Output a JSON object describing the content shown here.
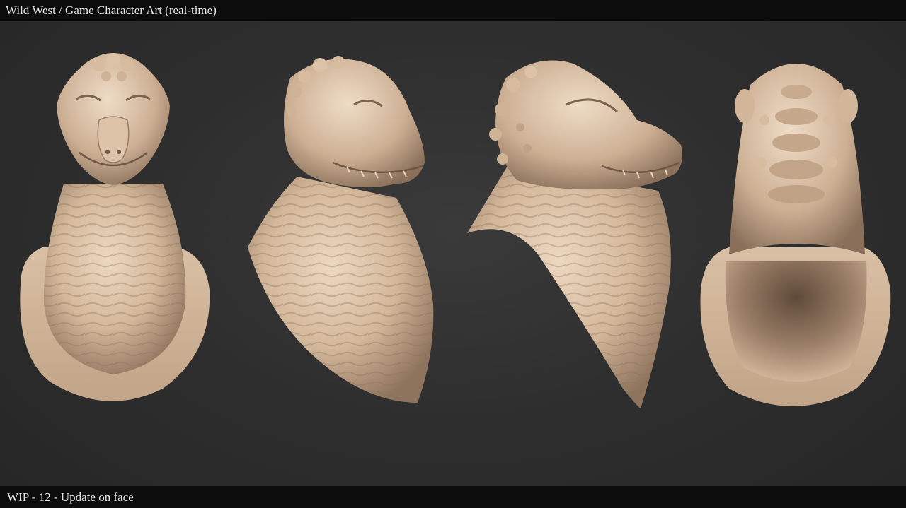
{
  "header": {
    "title": "Wild West / Game Character Art (real-time)"
  },
  "footer": {
    "caption": "WIP - 12 - Update on face"
  },
  "colors": {
    "background": "#2f2f2f",
    "bar": "#0c0c0c",
    "bar_text": "#e6e6e6",
    "clay": "#d9bfa3",
    "clay_shadow": "#8a705a",
    "clay_highlight": "#ecd8c0"
  },
  "views": [
    {
      "name": "front-view"
    },
    {
      "name": "three-quarter-view"
    },
    {
      "name": "side-view"
    },
    {
      "name": "back-bottom-view"
    }
  ]
}
